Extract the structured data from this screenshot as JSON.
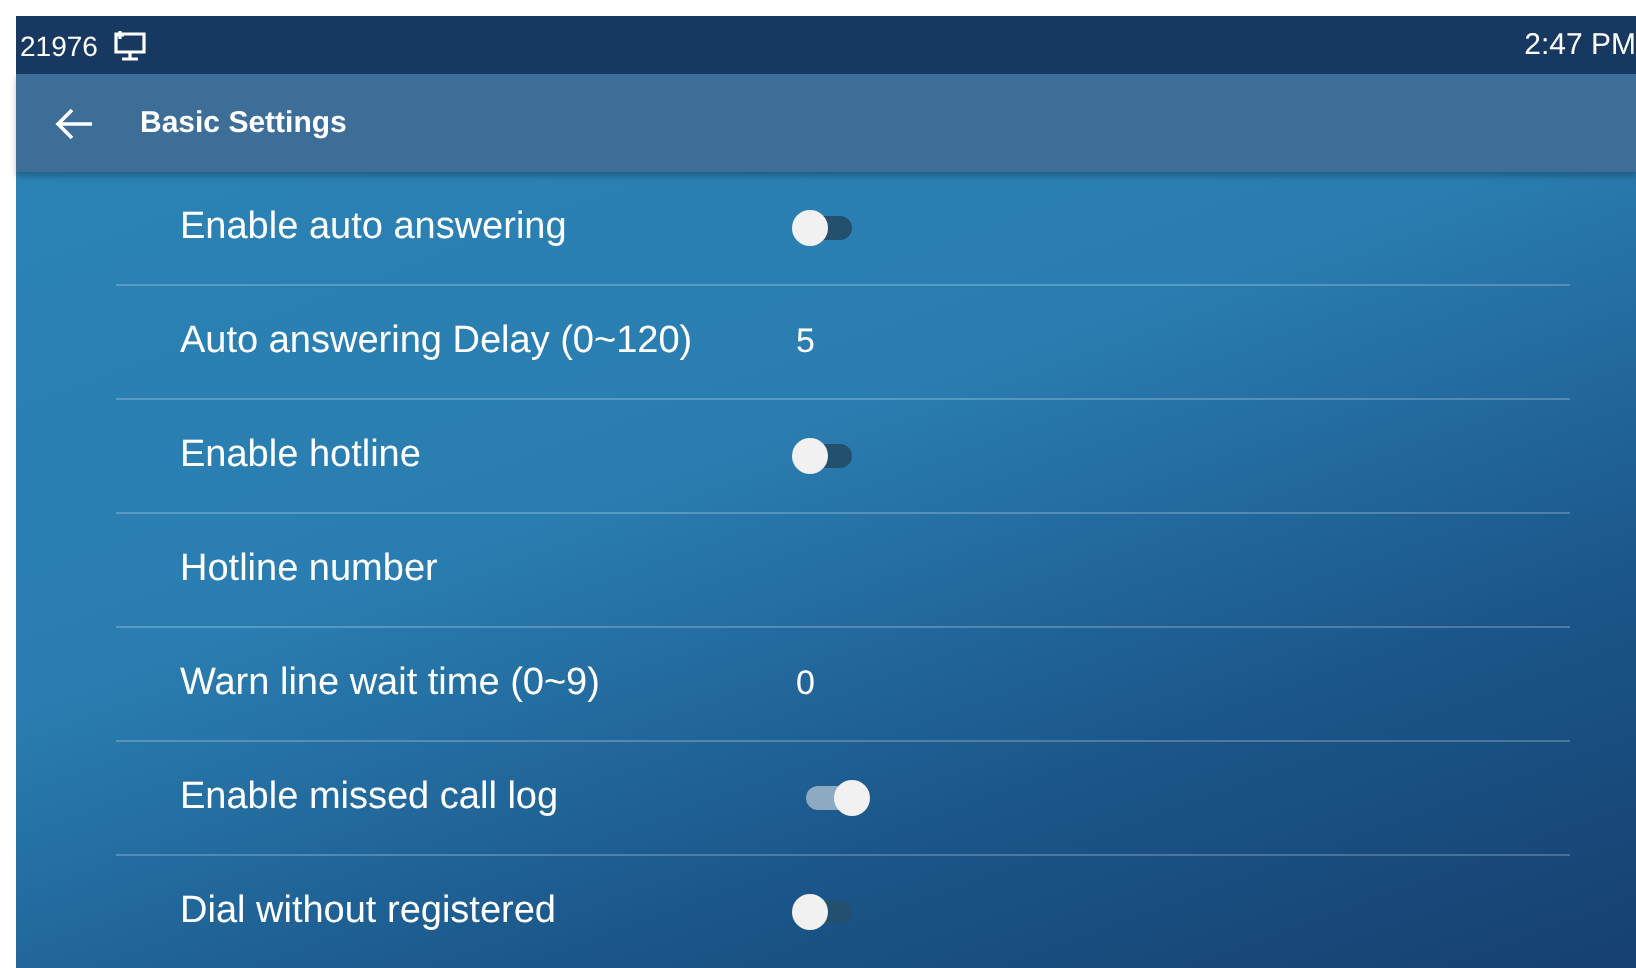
{
  "status_bar": {
    "extension": "21976",
    "time": "2:47 PM"
  },
  "header": {
    "title": "Basic Settings"
  },
  "settings": [
    {
      "label": "Enable auto answering",
      "kind": "toggle",
      "on": false
    },
    {
      "label": "Auto answering Delay (0~120)",
      "kind": "value",
      "value": "5"
    },
    {
      "label": "Enable hotline",
      "kind": "toggle",
      "on": false
    },
    {
      "label": "Hotline number",
      "kind": "value"
    },
    {
      "label": "Warn line wait time (0~9)",
      "kind": "value",
      "value": "0"
    },
    {
      "label": "Enable missed call log",
      "kind": "toggle",
      "on": true
    },
    {
      "label": "Dial without registered",
      "kind": "toggle",
      "on": false
    }
  ]
}
